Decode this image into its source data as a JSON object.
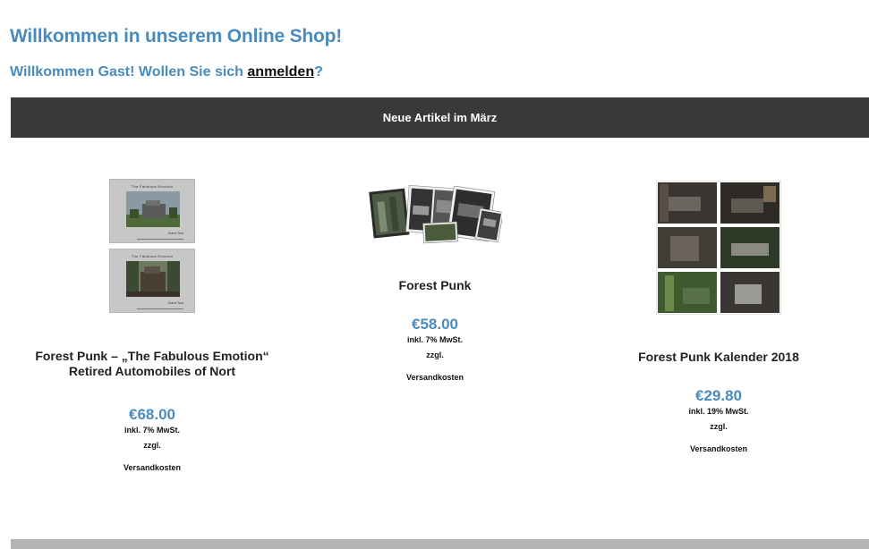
{
  "header": {
    "title": "Willkommen in unserem Online Shop!",
    "welcome_prefix": "Willkommen Gast! Wollen Sie sich ",
    "login_link": "anmelden",
    "welcome_suffix": "?"
  },
  "new_items_bar": {
    "label": "Neue Artikel im März"
  },
  "products": [
    {
      "title_line1": "Forest Punk – „The Fabulous Emotion“",
      "title_line2": "Retired Automobiles of Nort",
      "book_head": "The Fabulous Emotion",
      "book_foot": "Grand Tour",
      "price": "€68.00",
      "tax": "inkl. 7% MwSt.",
      "plus": "zzgl.",
      "shipping": "Versandkosten"
    },
    {
      "title": "Forest Punk",
      "price": "€58.00",
      "tax": "inkl. 7% MwSt.",
      "plus": "zzgl.",
      "shipping": "Versandkosten"
    },
    {
      "title": "Forest Punk Kalender 2018",
      "price": "€29.80",
      "tax": "inkl. 19% MwSt.",
      "plus": "zzgl.",
      "shipping": "Versandkosten"
    }
  ],
  "colors": {
    "accent": "#4a8bbd",
    "bar": "#393939",
    "footer": "#b3b3b3"
  }
}
